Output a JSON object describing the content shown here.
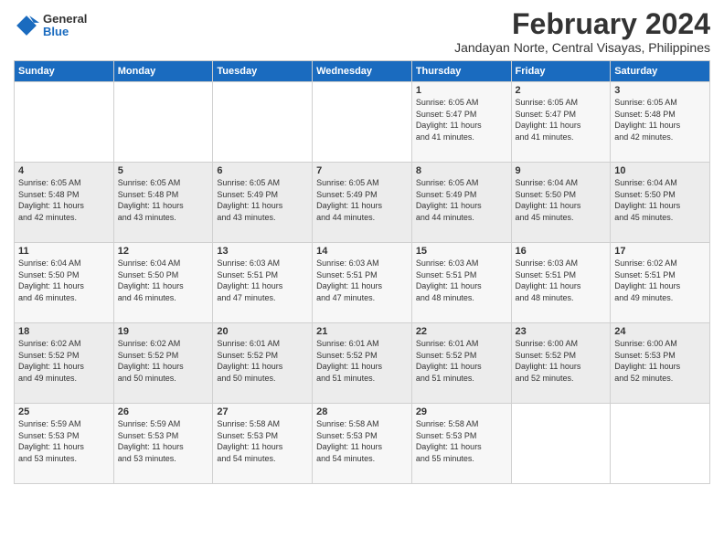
{
  "header": {
    "logo": {
      "line1": "General",
      "line2": "Blue"
    },
    "title": "February 2024",
    "location": "Jandayan Norte, Central Visayas, Philippines"
  },
  "weekdays": [
    "Sunday",
    "Monday",
    "Tuesday",
    "Wednesday",
    "Thursday",
    "Friday",
    "Saturday"
  ],
  "weeks": [
    [
      {
        "day": "",
        "info": ""
      },
      {
        "day": "",
        "info": ""
      },
      {
        "day": "",
        "info": ""
      },
      {
        "day": "",
        "info": ""
      },
      {
        "day": "1",
        "info": "Sunrise: 6:05 AM\nSunset: 5:47 PM\nDaylight: 11 hours\nand 41 minutes."
      },
      {
        "day": "2",
        "info": "Sunrise: 6:05 AM\nSunset: 5:47 PM\nDaylight: 11 hours\nand 41 minutes."
      },
      {
        "day": "3",
        "info": "Sunrise: 6:05 AM\nSunset: 5:48 PM\nDaylight: 11 hours\nand 42 minutes."
      }
    ],
    [
      {
        "day": "4",
        "info": "Sunrise: 6:05 AM\nSunset: 5:48 PM\nDaylight: 11 hours\nand 42 minutes."
      },
      {
        "day": "5",
        "info": "Sunrise: 6:05 AM\nSunset: 5:48 PM\nDaylight: 11 hours\nand 43 minutes."
      },
      {
        "day": "6",
        "info": "Sunrise: 6:05 AM\nSunset: 5:49 PM\nDaylight: 11 hours\nand 43 minutes."
      },
      {
        "day": "7",
        "info": "Sunrise: 6:05 AM\nSunset: 5:49 PM\nDaylight: 11 hours\nand 44 minutes."
      },
      {
        "day": "8",
        "info": "Sunrise: 6:05 AM\nSunset: 5:49 PM\nDaylight: 11 hours\nand 44 minutes."
      },
      {
        "day": "9",
        "info": "Sunrise: 6:04 AM\nSunset: 5:50 PM\nDaylight: 11 hours\nand 45 minutes."
      },
      {
        "day": "10",
        "info": "Sunrise: 6:04 AM\nSunset: 5:50 PM\nDaylight: 11 hours\nand 45 minutes."
      }
    ],
    [
      {
        "day": "11",
        "info": "Sunrise: 6:04 AM\nSunset: 5:50 PM\nDaylight: 11 hours\nand 46 minutes."
      },
      {
        "day": "12",
        "info": "Sunrise: 6:04 AM\nSunset: 5:50 PM\nDaylight: 11 hours\nand 46 minutes."
      },
      {
        "day": "13",
        "info": "Sunrise: 6:03 AM\nSunset: 5:51 PM\nDaylight: 11 hours\nand 47 minutes."
      },
      {
        "day": "14",
        "info": "Sunrise: 6:03 AM\nSunset: 5:51 PM\nDaylight: 11 hours\nand 47 minutes."
      },
      {
        "day": "15",
        "info": "Sunrise: 6:03 AM\nSunset: 5:51 PM\nDaylight: 11 hours\nand 48 minutes."
      },
      {
        "day": "16",
        "info": "Sunrise: 6:03 AM\nSunset: 5:51 PM\nDaylight: 11 hours\nand 48 minutes."
      },
      {
        "day": "17",
        "info": "Sunrise: 6:02 AM\nSunset: 5:51 PM\nDaylight: 11 hours\nand 49 minutes."
      }
    ],
    [
      {
        "day": "18",
        "info": "Sunrise: 6:02 AM\nSunset: 5:52 PM\nDaylight: 11 hours\nand 49 minutes."
      },
      {
        "day": "19",
        "info": "Sunrise: 6:02 AM\nSunset: 5:52 PM\nDaylight: 11 hours\nand 50 minutes."
      },
      {
        "day": "20",
        "info": "Sunrise: 6:01 AM\nSunset: 5:52 PM\nDaylight: 11 hours\nand 50 minutes."
      },
      {
        "day": "21",
        "info": "Sunrise: 6:01 AM\nSunset: 5:52 PM\nDaylight: 11 hours\nand 51 minutes."
      },
      {
        "day": "22",
        "info": "Sunrise: 6:01 AM\nSunset: 5:52 PM\nDaylight: 11 hours\nand 51 minutes."
      },
      {
        "day": "23",
        "info": "Sunrise: 6:00 AM\nSunset: 5:52 PM\nDaylight: 11 hours\nand 52 minutes."
      },
      {
        "day": "24",
        "info": "Sunrise: 6:00 AM\nSunset: 5:53 PM\nDaylight: 11 hours\nand 52 minutes."
      }
    ],
    [
      {
        "day": "25",
        "info": "Sunrise: 5:59 AM\nSunset: 5:53 PM\nDaylight: 11 hours\nand 53 minutes."
      },
      {
        "day": "26",
        "info": "Sunrise: 5:59 AM\nSunset: 5:53 PM\nDaylight: 11 hours\nand 53 minutes."
      },
      {
        "day": "27",
        "info": "Sunrise: 5:58 AM\nSunset: 5:53 PM\nDaylight: 11 hours\nand 54 minutes."
      },
      {
        "day": "28",
        "info": "Sunrise: 5:58 AM\nSunset: 5:53 PM\nDaylight: 11 hours\nand 54 minutes."
      },
      {
        "day": "29",
        "info": "Sunrise: 5:58 AM\nSunset: 5:53 PM\nDaylight: 11 hours\nand 55 minutes."
      },
      {
        "day": "",
        "info": ""
      },
      {
        "day": "",
        "info": ""
      }
    ]
  ]
}
